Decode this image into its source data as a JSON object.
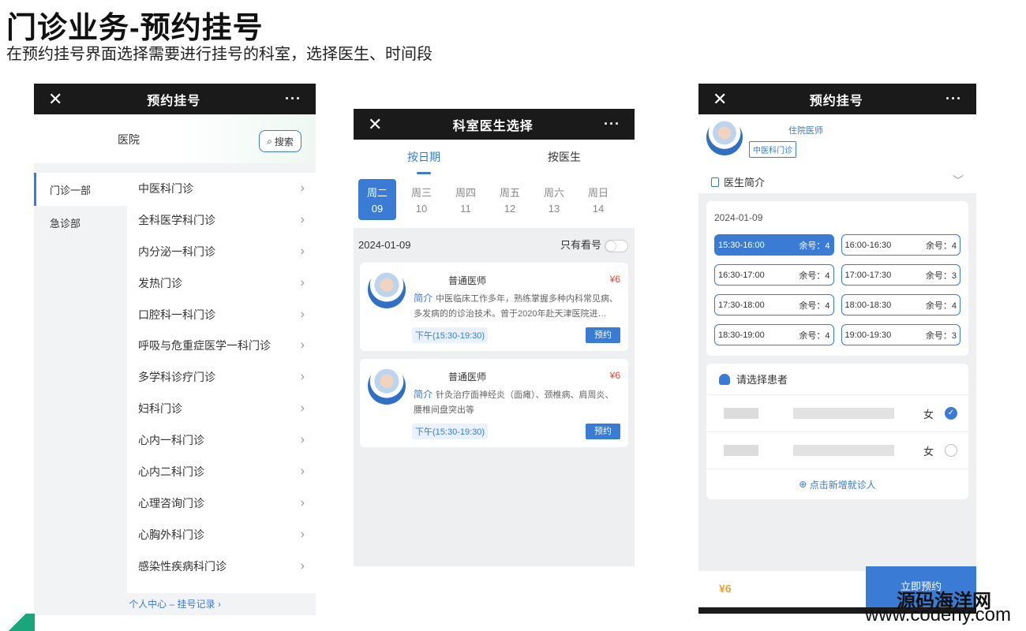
{
  "slide": {
    "title": "门诊业务-预约挂号",
    "subtitle": "在预约挂号界面选择需要进行挂号的科室，选择医生、时间段"
  },
  "colors": {
    "accent": "#3a7bd5",
    "price": "#e24a3b",
    "topbar": "#1a1a1a"
  },
  "phone1": {
    "topbar": {
      "close": "✕",
      "title": "预约挂号",
      "more": "···"
    },
    "hospital": "医院",
    "search_label": "搜索",
    "departments": [
      {
        "label": "门诊一部"
      },
      {
        "label": "急诊部"
      }
    ],
    "clinics": [
      "中医科门诊",
      "全科医学科门诊",
      "内分泌一科门诊",
      "发热门诊",
      "口腔科一科门诊",
      "呼吸与危重症医学一科门诊",
      "多学科诊疗门诊",
      "妇科门诊",
      "心内一科门诊",
      "心内二科门诊",
      "心理咨询门诊",
      "心胸外科门诊",
      "感染性疾病科门诊"
    ],
    "footer": "个人中心 – 挂号记录 ›"
  },
  "phone2": {
    "topbar": {
      "close": "✕",
      "title": "科室医生选择",
      "more": "···"
    },
    "tabs": [
      "按日期",
      "按医生"
    ],
    "days": [
      {
        "week": "周二",
        "day": "09"
      },
      {
        "week": "周三",
        "day": "10"
      },
      {
        "week": "周四",
        "day": "11"
      },
      {
        "week": "周五",
        "day": "12"
      },
      {
        "week": "周六",
        "day": "13"
      },
      {
        "week": "周日",
        "day": "14"
      }
    ],
    "date": "2024-01-09",
    "only_available": "只有看号",
    "doctors": [
      {
        "title": "普通医师",
        "price": "¥6",
        "intro_label": "简介",
        "intro": "中医临床工作多年，熟练掌握多种内科常见病、多发病的的诊治技术。曾于2020年赴天津医院进…",
        "time": "下午(15:30-19:30)",
        "book": "预约"
      },
      {
        "title": "普通医师",
        "price": "¥6",
        "intro_label": "简介",
        "intro": "针灸治疗面神经炎（面瘫）、颈椎病、肩周炎、腰椎间盘突出等",
        "time": "下午(15:30-19:30)",
        "book": "预约"
      }
    ]
  },
  "phone3": {
    "topbar": {
      "close": "✕",
      "title": "预约挂号",
      "more": "···"
    },
    "role": "住院医师",
    "dept": "中医科门诊",
    "intro_label": "医生简介",
    "date": "2024-01-09",
    "slots": [
      {
        "time": "15:30-16:00",
        "remain": "余号：4"
      },
      {
        "time": "16:00-16:30",
        "remain": "余号：4"
      },
      {
        "time": "16:30-17:00",
        "remain": "余号：4"
      },
      {
        "time": "17:00-17:30",
        "remain": "余号：3"
      },
      {
        "time": "17:30-18:00",
        "remain": "余号：4"
      },
      {
        "time": "18:00-18:30",
        "remain": "余号：4"
      },
      {
        "time": "18:30-19:00",
        "remain": "余号：4"
      },
      {
        "time": "19:00-19:30",
        "remain": "余号：3"
      }
    ],
    "patient_header": "请选择患者",
    "patients": [
      {
        "sex": "女"
      },
      {
        "sex": "女"
      }
    ],
    "add_patient": "点击新增就诊人",
    "price": "¥6",
    "book_now": "立即预约"
  },
  "watermark": {
    "line1": "源码海洋网",
    "line2": "www.codeny.com"
  }
}
